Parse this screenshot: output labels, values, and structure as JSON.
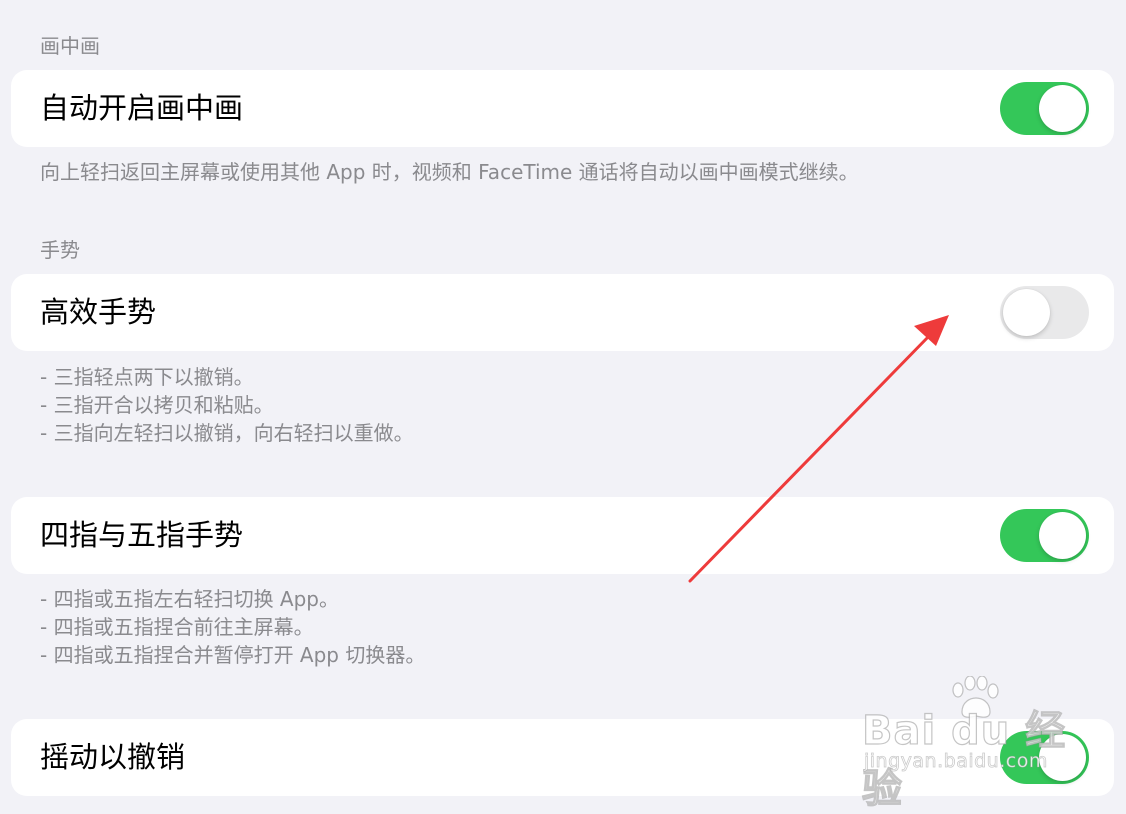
{
  "pip": {
    "header": "画中画",
    "row": {
      "label": "自动开启画中画",
      "toggle_on": true
    },
    "footer": "向上轻扫返回主屏幕或使用其他 App 时，视频和 FaceTime 通话将自动以画中画模式继续。"
  },
  "gestures": {
    "header": "手势",
    "efficient": {
      "label": "高效手势",
      "toggle_on": false,
      "footer": [
        "- 三指轻点两下以撤销。",
        "- 三指开合以拷贝和粘贴。",
        "- 三指向左轻扫以撤销，向右轻扫以重做。"
      ]
    },
    "four_five": {
      "label": "四指与五指手势",
      "toggle_on": true,
      "footer": [
        "- 四指或五指左右轻扫切换 App。",
        "- 四指或五指捏合前往主屏幕。",
        "- 四指或五指捏合并暂停打开 App 切换器。"
      ]
    },
    "shake": {
      "label": "摇动以撤销",
      "toggle_on": true
    }
  },
  "annotation": {
    "arrow_color": "#ee3b3b"
  },
  "watermark": {
    "logo": "Bai du 经验",
    "url": "jingyan.baidu.com"
  },
  "colors": {
    "toggle_on": "#34c759",
    "toggle_off": "#e9e9ea",
    "background": "#f2f2f7",
    "secondary_text": "#8a8a8e"
  }
}
